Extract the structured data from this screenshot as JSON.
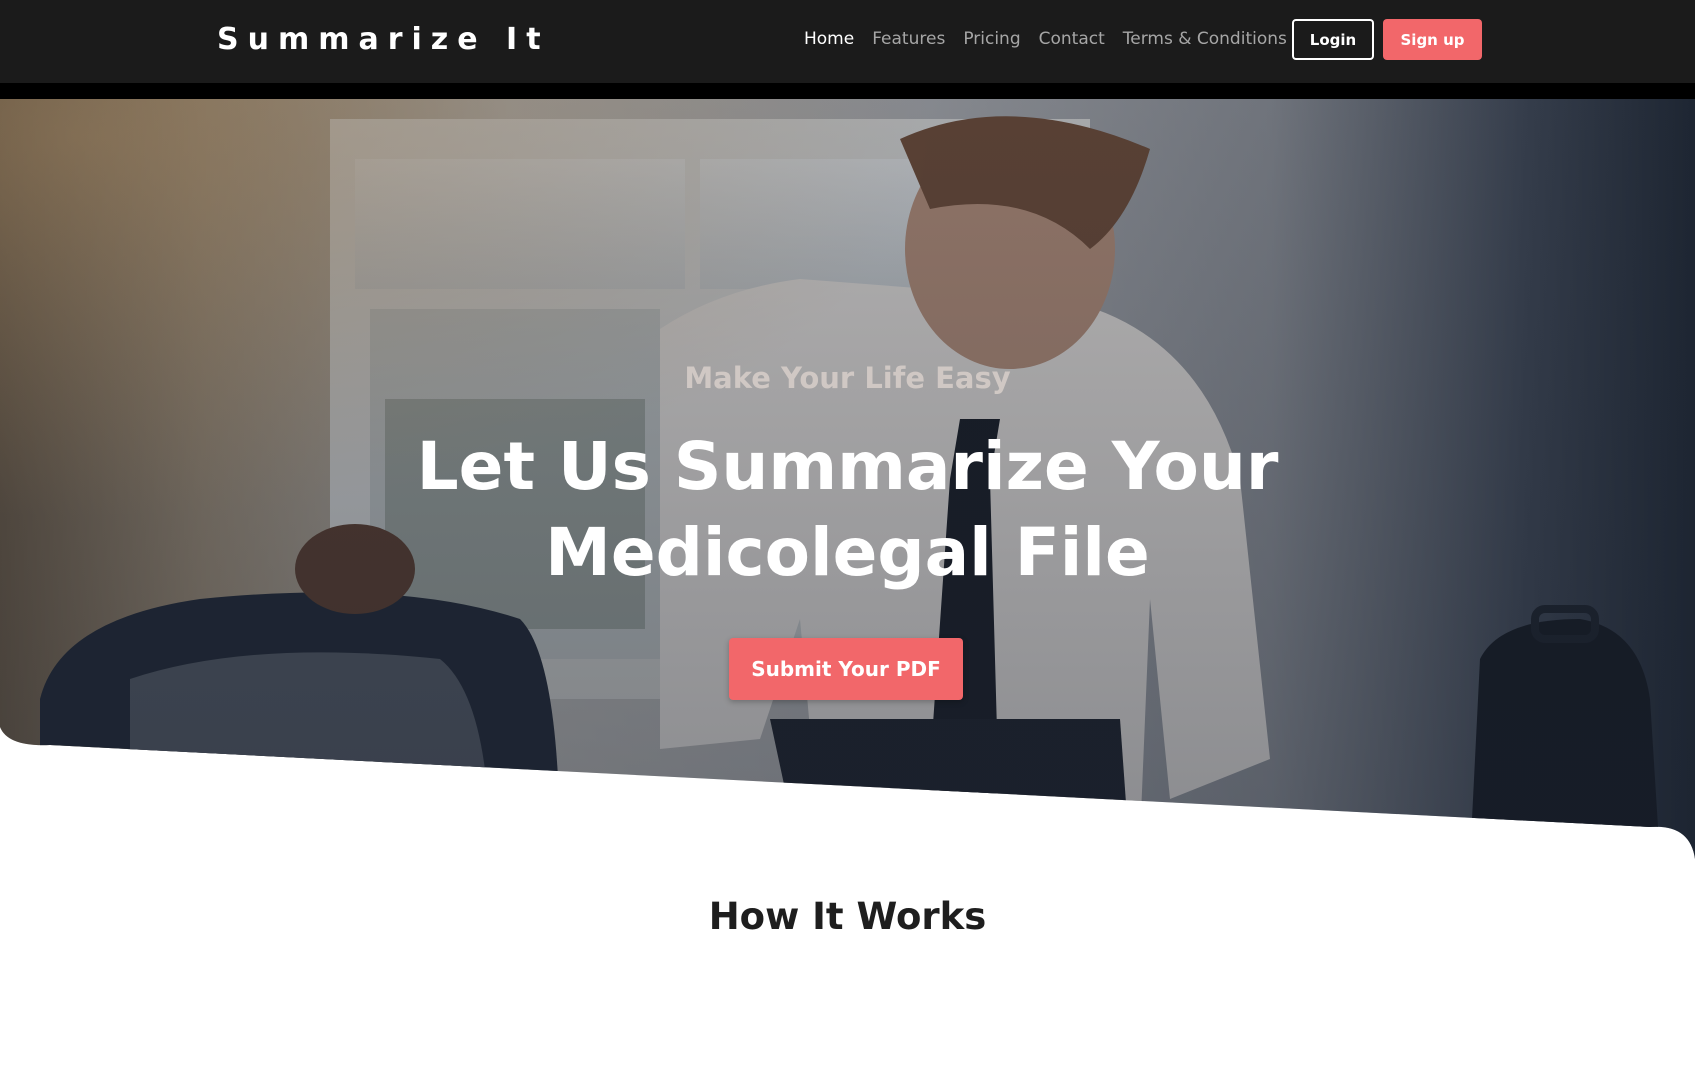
{
  "brand": {
    "name": "Summarize It"
  },
  "nav": {
    "links": [
      {
        "label": "Home",
        "active": true
      },
      {
        "label": "Features",
        "active": false
      },
      {
        "label": "Pricing",
        "active": false
      },
      {
        "label": "Contact",
        "active": false
      },
      {
        "label": "Terms & Conditions",
        "active": false
      }
    ],
    "login_label": "Login",
    "signup_label": "Sign up"
  },
  "hero": {
    "tagline": "Make Your Life Easy",
    "headline": "Let Us Summarize Your Medicolegal File",
    "cta_label": "Submit Your PDF"
  },
  "how_it_works": {
    "title": "How It Works"
  },
  "colors": {
    "navbar_bg": "#1b1b1b",
    "accent": "#f2676a",
    "text_dark": "#1e1e1e",
    "nav_inactive": "#a6a6a6"
  }
}
